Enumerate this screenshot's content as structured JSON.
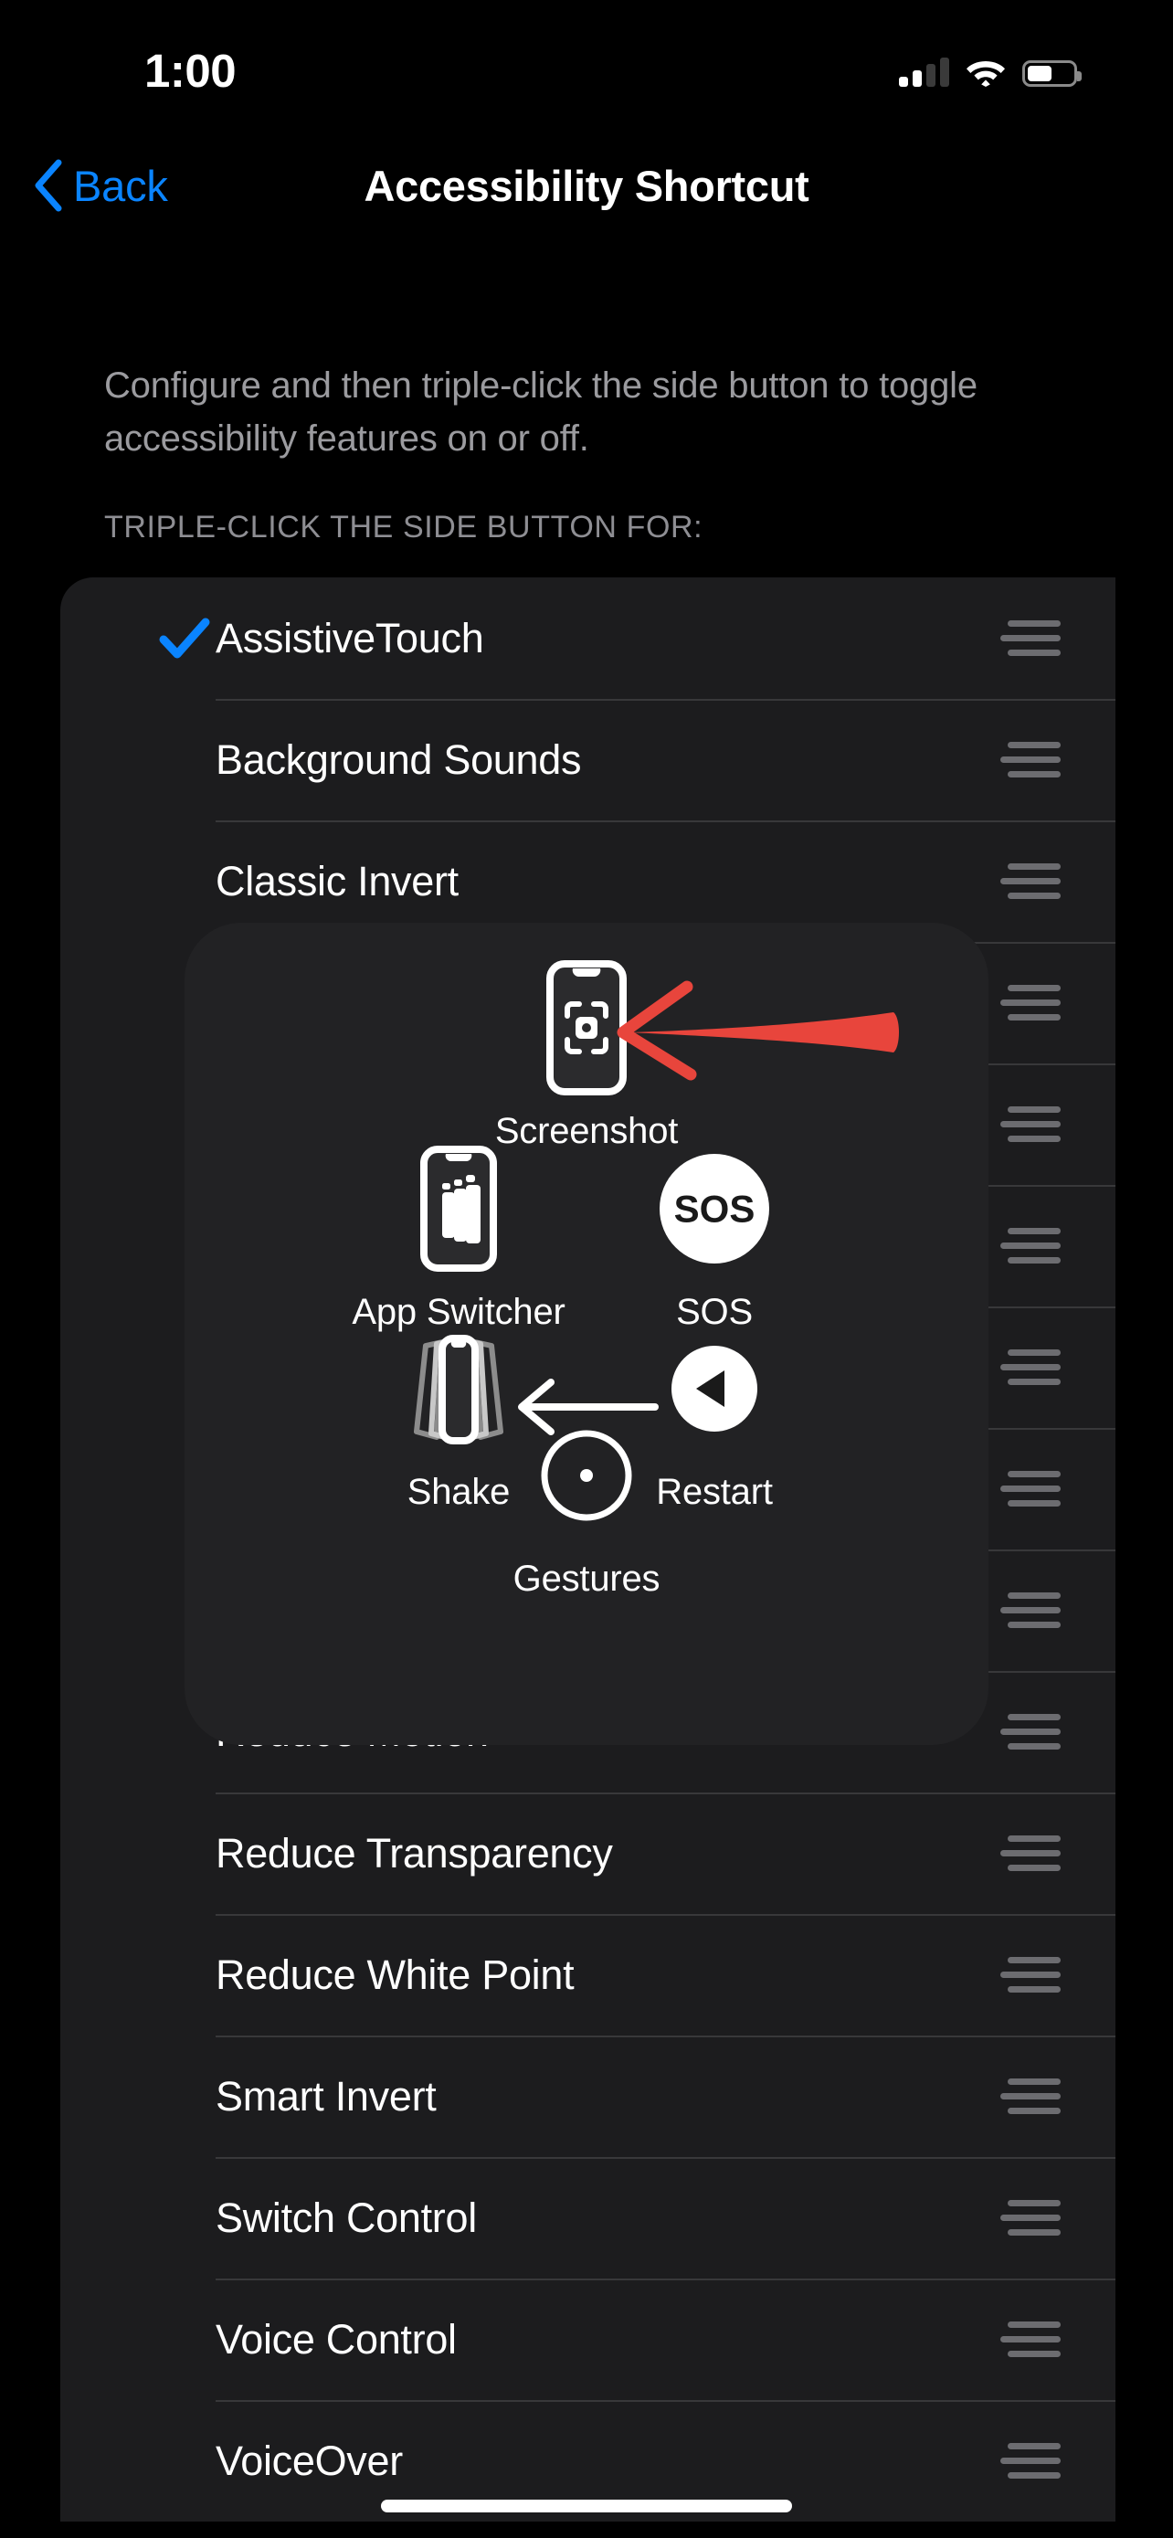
{
  "status_bar": {
    "time": "1:00",
    "signal_bars_total": 4,
    "signal_bars_active": 2,
    "wifi_icon": "wifi-icon",
    "battery_icon": "battery-icon",
    "battery_level_percent": 55
  },
  "nav_bar": {
    "back_label": "Back",
    "back_icon": "chevron-left-icon",
    "title": "Accessibility Shortcut",
    "accent_color": "#0a84ff"
  },
  "description": "Configure and then triple-click the side button to toggle accessibility features on or off.",
  "section_header": "TRIPLE-CLICK THE SIDE BUTTON FOR:",
  "list": {
    "rows": [
      {
        "label": "AssistiveTouch",
        "checked": true,
        "handle_icon": "reorder-handle-icon"
      },
      {
        "label": "Background Sounds",
        "checked": false,
        "handle_icon": "reorder-handle-icon"
      },
      {
        "label": "Classic Invert",
        "checked": false,
        "handle_icon": "reorder-handle-icon"
      },
      {
        "label": "",
        "checked": false,
        "handle_icon": "reorder-handle-icon"
      },
      {
        "label": "",
        "checked": false,
        "handle_icon": "reorder-handle-icon"
      },
      {
        "label": "",
        "checked": false,
        "handle_icon": "reorder-handle-icon"
      },
      {
        "label": "",
        "checked": false,
        "handle_icon": "reorder-handle-icon"
      },
      {
        "label": "",
        "checked": false,
        "handle_icon": "reorder-handle-icon"
      },
      {
        "label": "",
        "checked": false,
        "handle_icon": "reorder-handle-icon"
      },
      {
        "label": "Reduce Motion",
        "checked": false,
        "handle_icon": "reorder-handle-icon"
      },
      {
        "label": "Reduce Transparency",
        "checked": false,
        "handle_icon": "reorder-handle-icon"
      },
      {
        "label": "Reduce White Point",
        "checked": false,
        "handle_icon": "reorder-handle-icon"
      },
      {
        "label": "Smart Invert",
        "checked": false,
        "handle_icon": "reorder-handle-icon"
      },
      {
        "label": "Switch Control",
        "checked": false,
        "handle_icon": "reorder-handle-icon"
      },
      {
        "label": "Voice Control",
        "checked": false,
        "handle_icon": "reorder-handle-icon"
      },
      {
        "label": "VoiceOver",
        "checked": false,
        "handle_icon": "reorder-handle-icon"
      }
    ],
    "checkmark_color": "#0a84ff"
  },
  "assistive_touch_menu": {
    "items": [
      {
        "id": "screenshot",
        "label": "Screenshot",
        "icon": "screenshot-icon"
      },
      {
        "id": "app-switcher",
        "label": "App Switcher",
        "icon": "app-switcher-icon"
      },
      {
        "id": "sos",
        "label": "SOS",
        "icon": "sos-icon",
        "icon_text": "SOS"
      },
      {
        "id": "shake",
        "label": "Shake",
        "icon": "shake-icon"
      },
      {
        "id": "restart",
        "label": "Restart",
        "icon": "restart-icon"
      },
      {
        "id": "gestures",
        "label": "Gestures",
        "icon": "gestures-icon"
      }
    ],
    "back_arrow_icon": "arrow-left-icon",
    "background_color": "#222224"
  },
  "annotation": {
    "arrow_icon": "red-arrow-left-icon",
    "color": "#e8453c",
    "points_to": "screenshot-icon"
  },
  "home_indicator": "home-indicator"
}
